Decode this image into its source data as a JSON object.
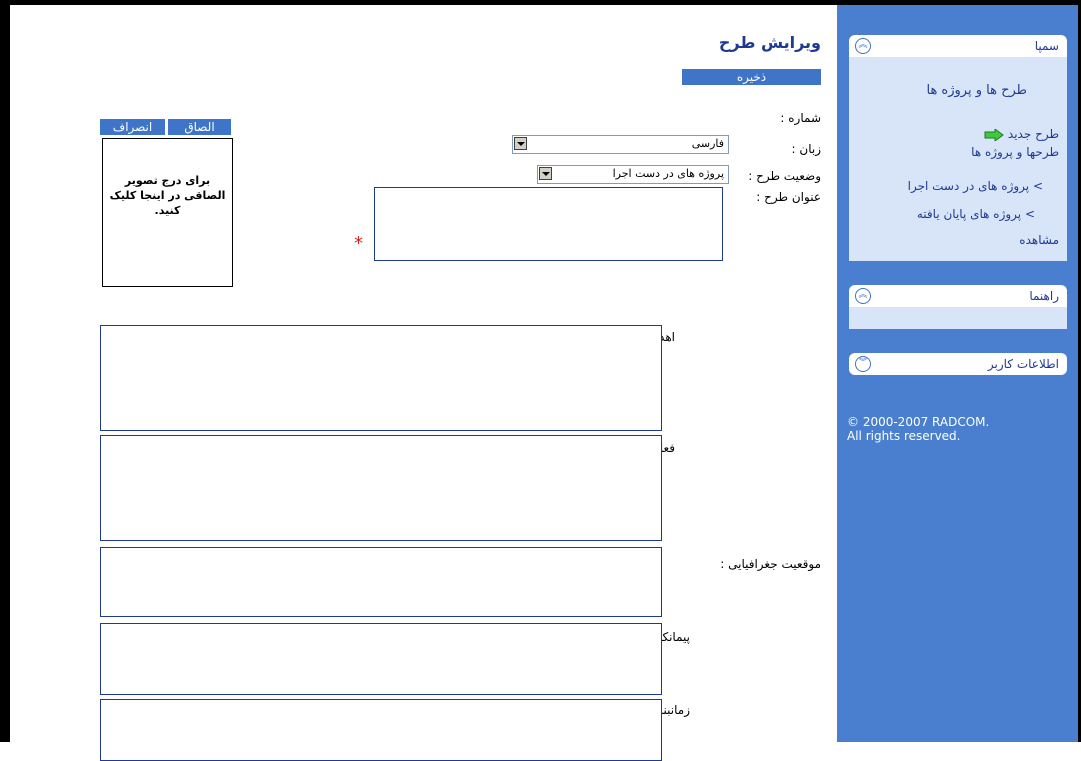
{
  "page": {
    "title": "ویرایش طرح",
    "save_label": "ذخیره",
    "paste_label": "الصاق",
    "cancel_label": "انصراف",
    "image_placeholder": "برای درج تصویر الصاقی در اینجا کلیک کنید.",
    "required_mark": "*"
  },
  "form": {
    "number_label": "شماره :",
    "language_label": "زبان :",
    "language_value": "فارسی",
    "status_label": "وضعیت طرح :",
    "status_value": "پروژه های در دست اجرا",
    "title_label": "عنوان طرح :",
    "goals_label": "اهداف طرح :",
    "activity_label": "فعالیت اجرایی :",
    "location_label": "موقعیت جغرافیایی :",
    "contractor_label": "پیمانکار اصلی :",
    "schedule_label": "زمانبندی طرح :"
  },
  "sidebar": {
    "panel1_title": "سمپا",
    "panel1_subtitle": "طرح ها و پروژه ها",
    "new_plan": "طرح جدید",
    "plans_projects": "طرحها و پروژه ها",
    "projects_in_progress": "> پروژه های در دست اجرا",
    "projects_finished": "> پروژه های پایان یافته",
    "view": "مشاهده",
    "panel2_title": "راهنما",
    "panel3_title": "اطلاعات کاربر",
    "copyright_line1": "© 2000-2007 RADCOM.",
    "copyright_line2": "All rights reserved."
  },
  "colors": {
    "sidebar_bg": "#4a7fd0",
    "accent": "#3e75c8",
    "title": "#1f3a93",
    "required": "#e0201f"
  },
  "icons": {
    "new_plan": "green-arrow-icon",
    "collapse": "double-chevron-up-icon",
    "expand": "double-chevron-down-icon"
  }
}
